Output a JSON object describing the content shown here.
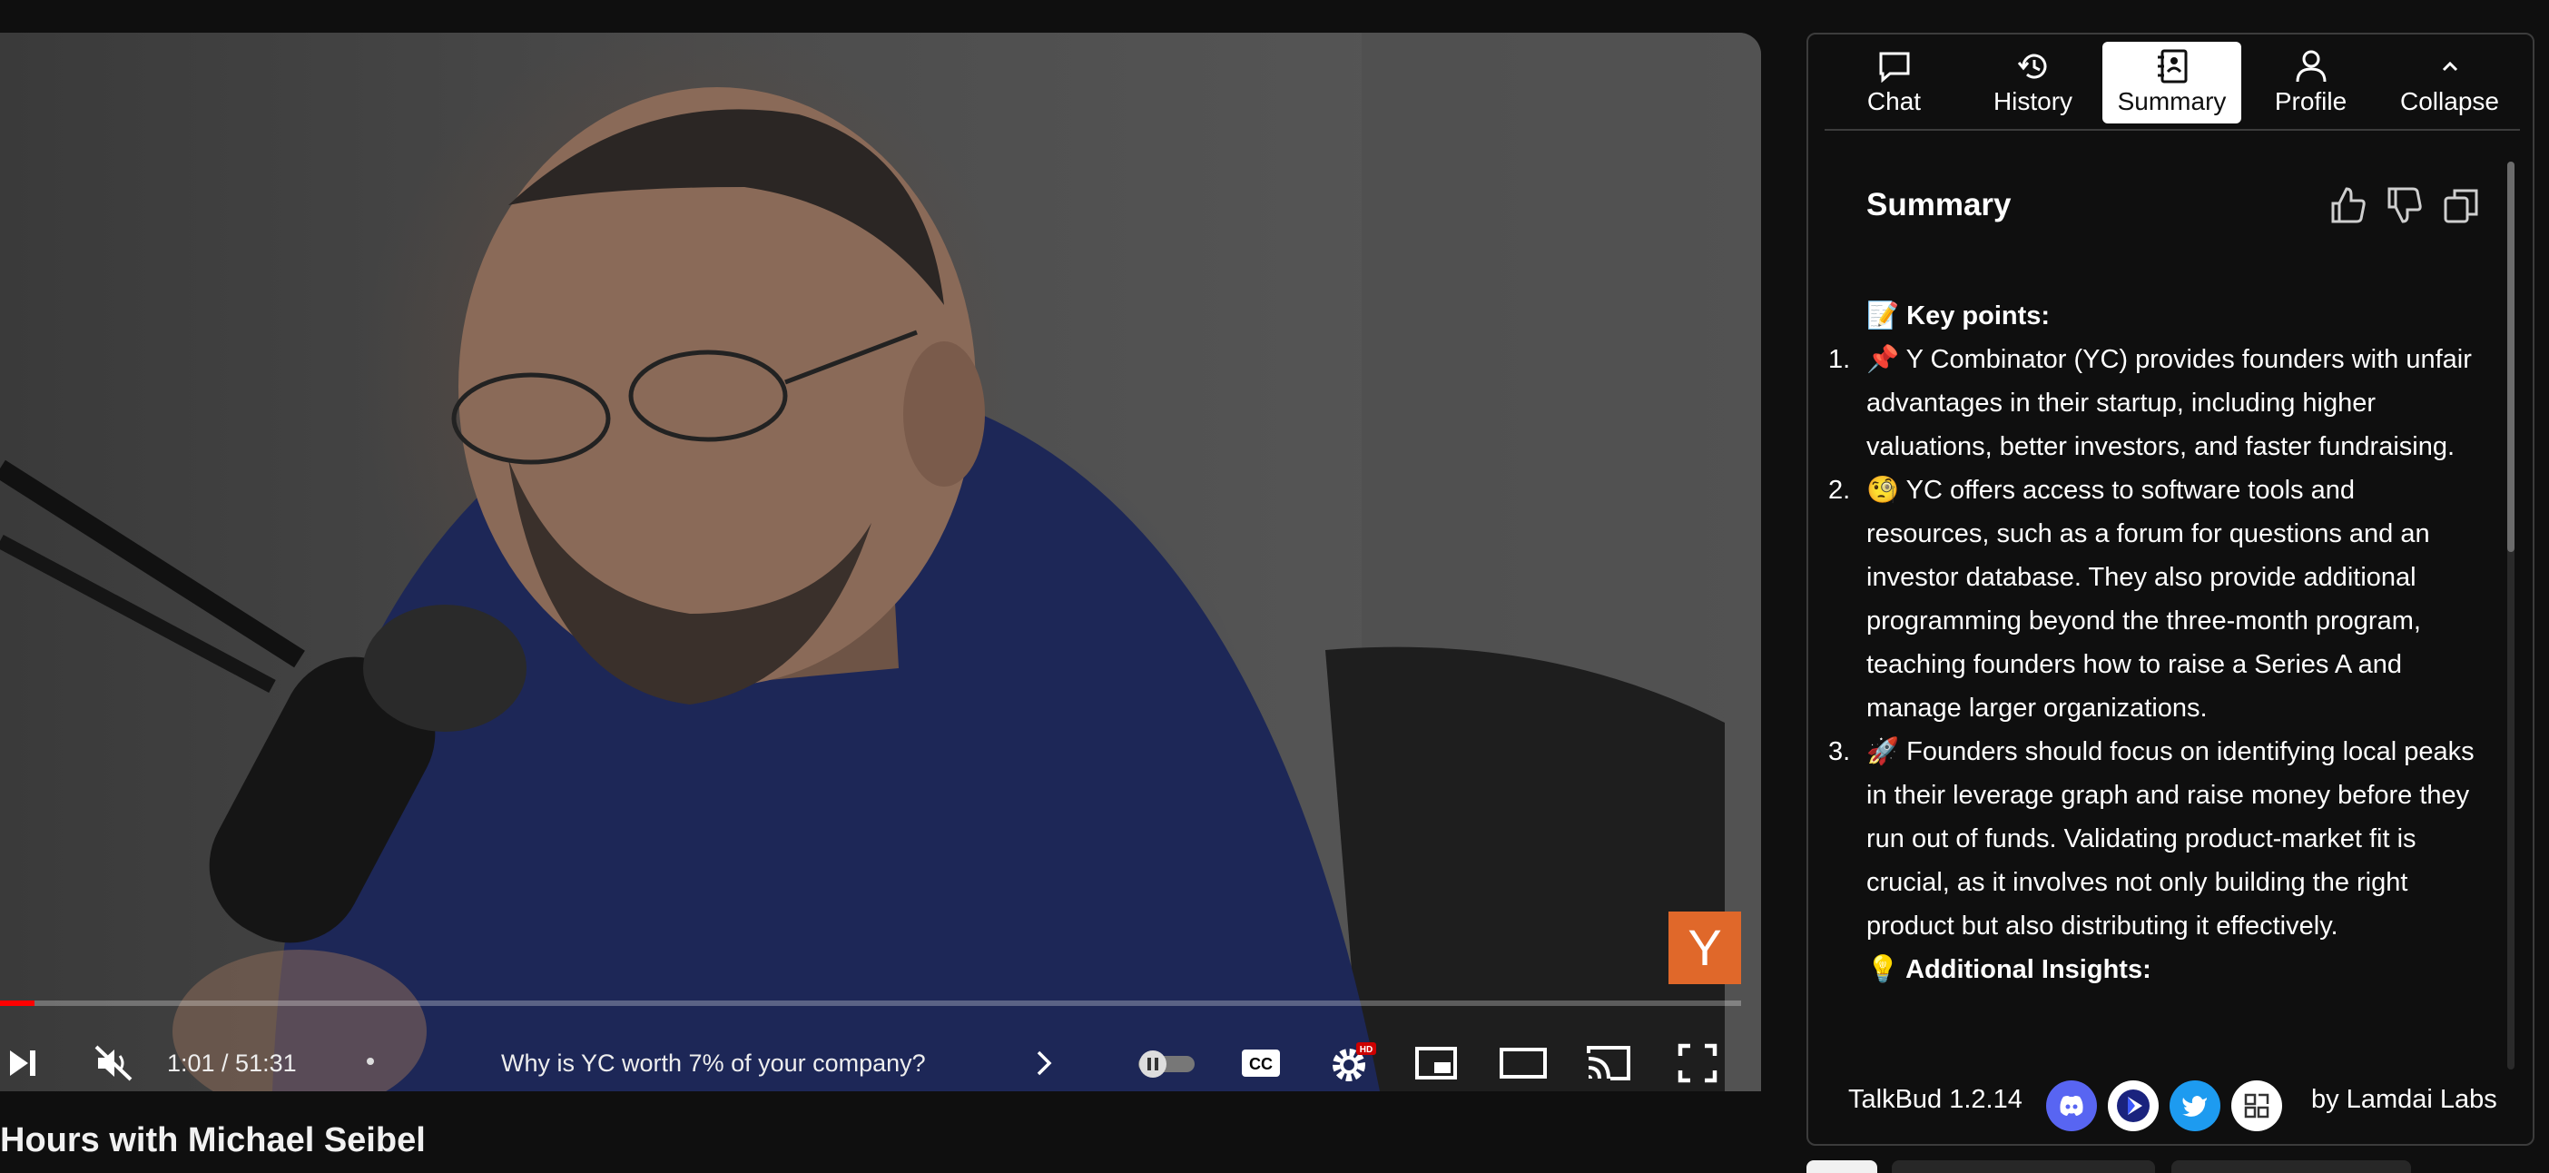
{
  "player": {
    "elapsed": "1:01",
    "duration": "51:31",
    "time_display": "1:01 / 51:31",
    "progress_fraction": 0.02,
    "chapter_title": "Why is YC worth 7% of your company?",
    "channel_logo_letter": "Y",
    "settings_badge": "HD"
  },
  "video": {
    "title_visible": "Hours with Michael Seibel"
  },
  "panel": {
    "tabs": [
      {
        "label": "Chat",
        "icon": "chat-bubble-icon"
      },
      {
        "label": "History",
        "icon": "history-clock-icon"
      },
      {
        "label": "Summary",
        "icon": "summary-notebook-icon",
        "active": true
      },
      {
        "label": "Profile",
        "icon": "profile-person-icon"
      },
      {
        "label": "Collapse",
        "icon": "chevron-up-icon"
      }
    ],
    "summary_title": "Summary",
    "key_points_heading": "📝 Key points:",
    "points": [
      {
        "num": "1.",
        "text": "📌 Y Combinator (YC) provides founders with unfair advantages in their startup, including higher valuations, better investors, and faster fundraising."
      },
      {
        "num": "2.",
        "text": "🧐 YC offers access to software tools and resources, such as a forum for questions and an investor database. They also provide additional programming beyond the three-month program, teaching founders how to raise a Series A and manage larger organizations."
      },
      {
        "num": "3.",
        "text": "🚀 Founders should focus on identifying local peaks in their leverage graph and raise money before they run out of funds. Validating product-market fit is crucial, as it involves not only building the right product but also distributing it effectively."
      }
    ],
    "insights_heading": "💡 Additional Insights:",
    "footer": {
      "version": "TalkBud 1.2.14",
      "byline": "by Lamdai Labs"
    }
  },
  "colors": {
    "accent_progress": "#ff0000",
    "yc_orange": "#e0682a",
    "discord": "#5865f2",
    "twitter": "#1d9bf0"
  }
}
